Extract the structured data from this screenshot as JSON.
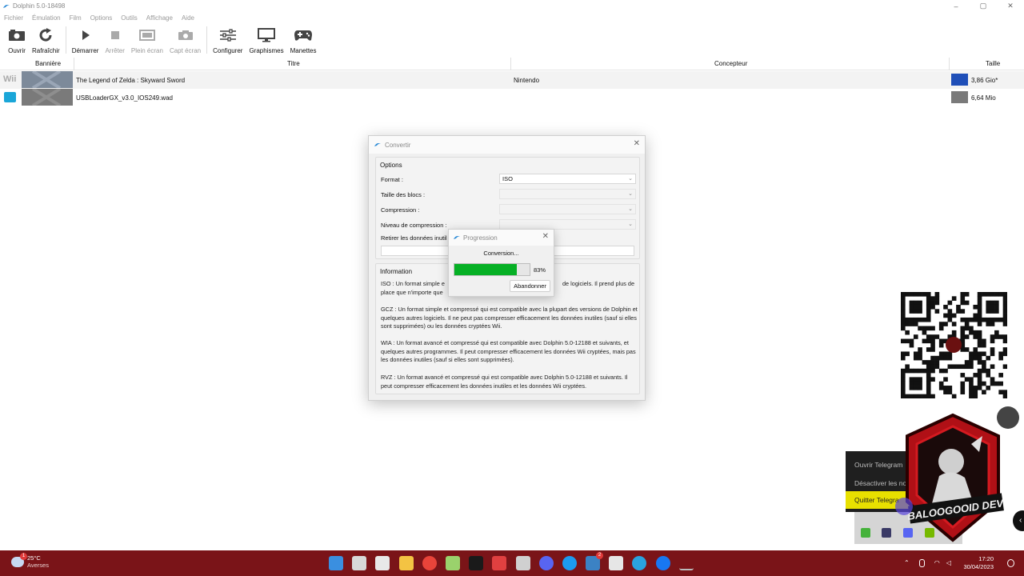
{
  "window": {
    "title": "Dolphin 5.0-18498"
  },
  "menu": [
    "Fichier",
    "Émulation",
    "Film",
    "Options",
    "Outils",
    "Affichage",
    "Aide"
  ],
  "toolbar": {
    "open": "Ouvrir",
    "refresh": "Rafraîchir",
    "start": "Démarrer",
    "stop": "Arrêter",
    "fullscreen": "Plein écran",
    "screenshot": "Capt écran",
    "configure": "Configurer",
    "graphics": "Graphismes",
    "controllers": "Manettes"
  },
  "table": {
    "headers": {
      "banner": "Bannière",
      "title": "Titre",
      "maker": "Concepteur",
      "size": "Taille"
    },
    "rows": [
      {
        "platform": "Wii",
        "title": "The Legend of Zelda : Skyward Sword",
        "maker": "Nintendo",
        "size": "3,86 Gio*"
      },
      {
        "platform": "WAD",
        "title": "USBLoaderGX_v3.0_IOS249.wad",
        "maker": "",
        "size": "6,64 Mio"
      }
    ]
  },
  "convert_dialog": {
    "title": "Convertir",
    "options_title": "Options",
    "format_label": "Format :",
    "format_value": "ISO",
    "block_size_label": "Taille des blocs :",
    "compression_label": "Compression :",
    "compression_level_label": "Niveau de compression :",
    "remove_junk_label": "Retirer les données inutil",
    "info_title": "Information",
    "info_iso_a": "ISO : Un format simple e",
    "info_iso_b": "de logiciels. Il prend plus de",
    "info_iso_c": "place que n'importe que",
    "info_gcz": "GCZ : Un format simple et compressé qui est compatible avec la plupart des versions de Dolphin et quelques autres logiciels.  Il ne peut pas compresser efficacement les données inutiles (sauf si elles sont supprimées) ou les données cryptées Wii.",
    "info_wia": "WIA : Un format avancé et compressé qui est compatible avec Dolphin 5.0-12188 et suivants, et quelques autres programmes. Il peut compresser efficacement les données Wii cryptées, mais pas les données inutiles (sauf si elles sont supprimées).",
    "info_rvz": "RVZ : Un format avancé et compressé qui est compatible avec Dolphin 5.0-12188 et suivants. Il peut compresser efficacement les données inutiles et les données Wii cryptées."
  },
  "progress_dialog": {
    "title": "Progression",
    "status": "Conversion...",
    "percent_text": "83%",
    "percent": 83,
    "cancel": "Abandonner"
  },
  "tray_menu": {
    "open": "Ouvrir Telegram",
    "disable": "Désactiver les notif",
    "quit": "Quitter Telegra"
  },
  "watermark": {
    "text": "BALOOGOOID DEV"
  },
  "taskbar": {
    "temperature": "25°C",
    "weather": "Averses",
    "time": "17:20",
    "date": "30/04/2023",
    "weather_badge": "1",
    "notification_badge": "2"
  },
  "colors": {
    "progress": "#06b025",
    "taskbar": "#7a1418",
    "highlight": "#e8e000"
  }
}
